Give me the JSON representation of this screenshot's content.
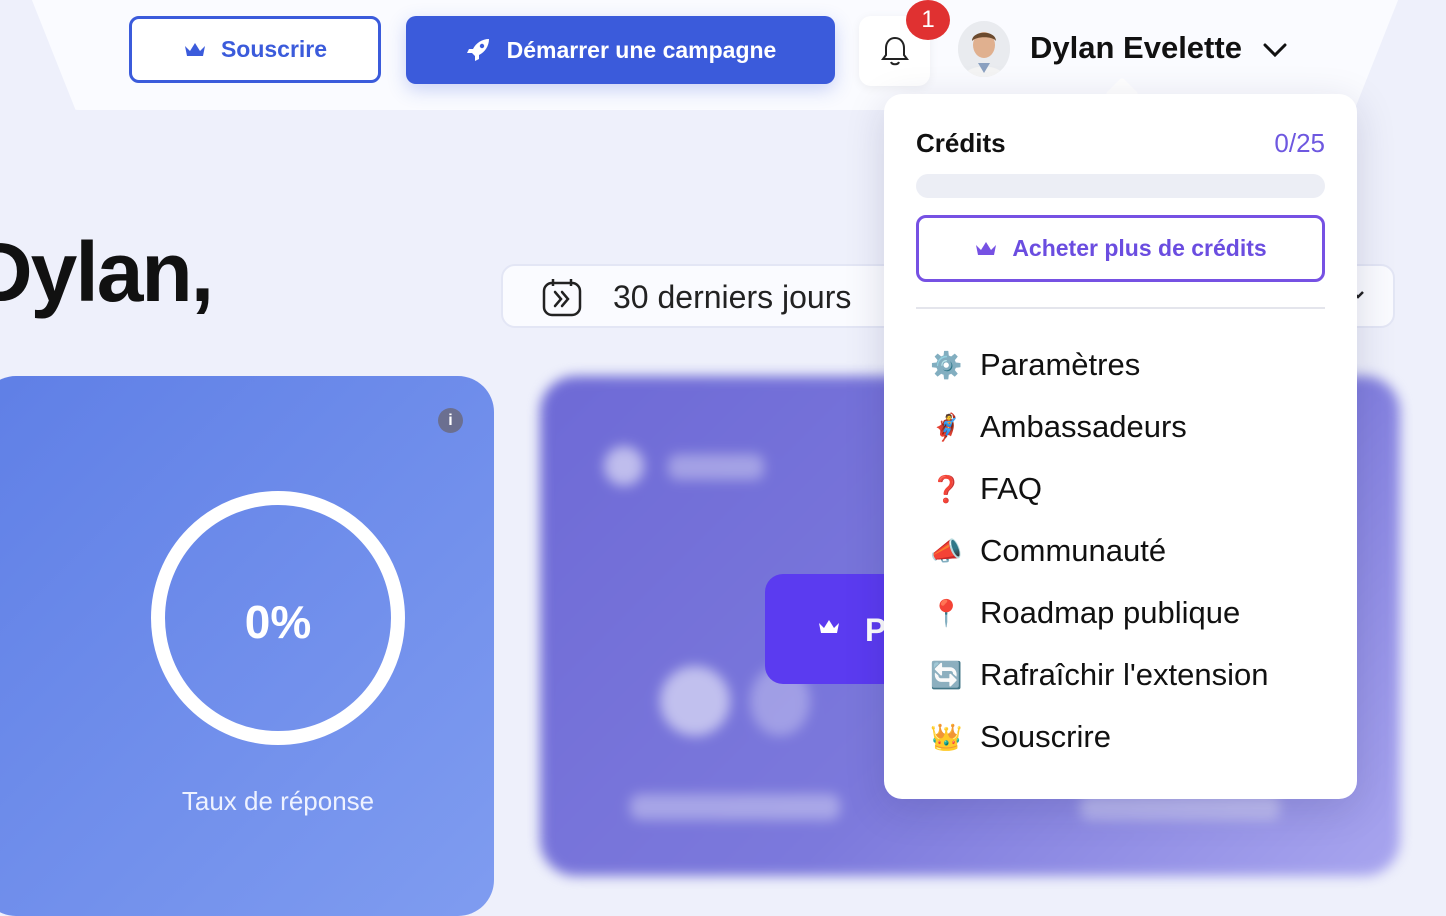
{
  "header": {
    "subscribe_label": "Souscrire",
    "campaign_label": "Démarrer une campagne",
    "notification_count": "1",
    "user_name": "Dylan Evelette"
  },
  "dashboard": {
    "greeting": "Dylan,",
    "date_range": "30 derniers jours",
    "response_rate": {
      "value": "0%",
      "label": "Taux de réponse"
    },
    "premium_button_partial": "P"
  },
  "menu": {
    "credits_label": "Crédits",
    "credits_value": "0/25",
    "credits_used_fraction": 0,
    "buy_credits_label": "Acheter plus de crédits",
    "items": [
      {
        "icon": "gear-icon",
        "emoji": "⚙️",
        "label": "Paramètres"
      },
      {
        "icon": "superhero-icon",
        "emoji": "🦸",
        "label": "Ambassadeurs"
      },
      {
        "icon": "question-icon",
        "emoji": "❓",
        "label": "FAQ"
      },
      {
        "icon": "megaphone-icon",
        "emoji": "📣",
        "label": "Communauté"
      },
      {
        "icon": "pin-icon",
        "emoji": "📍",
        "label": "Roadmap publique"
      },
      {
        "icon": "refresh-icon",
        "emoji": "🔄",
        "label": "Rafraîchir l'extension"
      },
      {
        "icon": "crown-icon",
        "emoji": "👑",
        "label": "Souscrire"
      }
    ]
  },
  "colors": {
    "primary": "#3b5bdb",
    "accent_purple": "#6e58e0",
    "badge_red": "#e03131",
    "card_blue": "#6f8deb"
  }
}
